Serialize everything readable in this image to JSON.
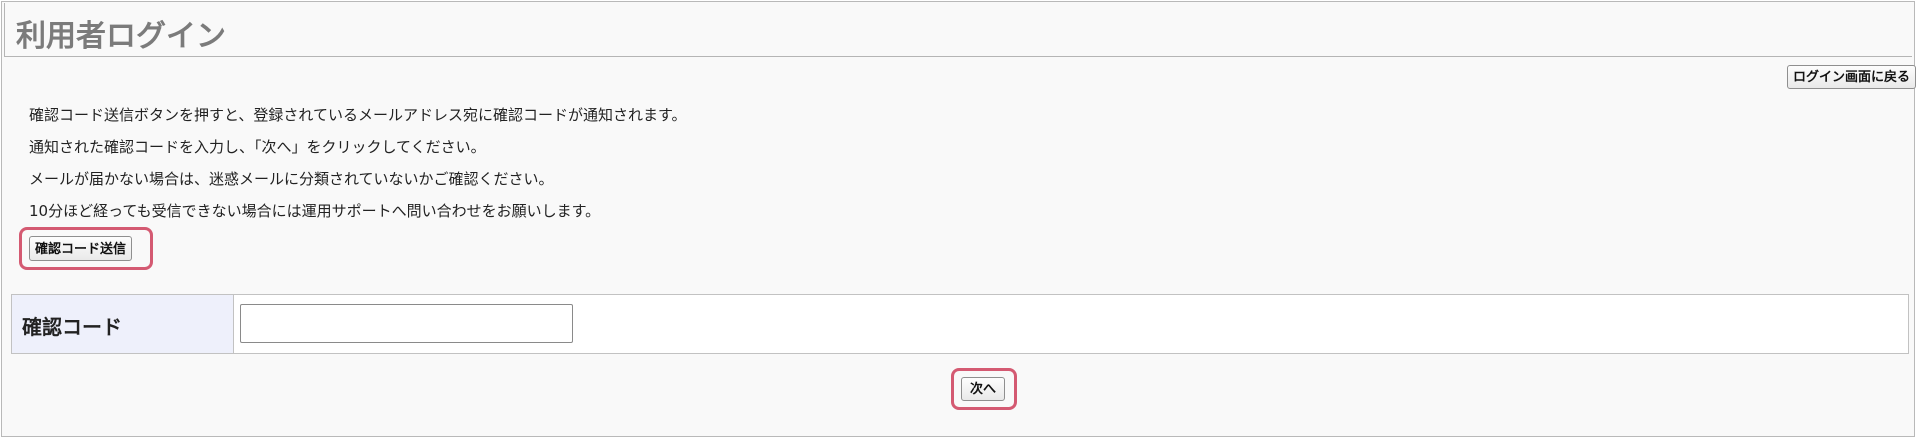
{
  "header": {
    "title": "利用者ログイン"
  },
  "toolbar": {
    "back_label": "ログイン画面に戻る"
  },
  "instructions": [
    "確認コード送信ボタンを押すと、登録されているメールアドレス宛に確認コードが通知されます。",
    "通知された確認コードを入力し、「次へ」をクリックしてください。",
    "メールが届かない場合は、迷惑メールに分類されていないかご確認ください。",
    "10分ほど経っても受信できない場合には運用サポートへ問い合わせをお願いします。"
  ],
  "send_code_button": {
    "label": "確認コード送信"
  },
  "form": {
    "code_label": "確認コード",
    "code_value": "",
    "code_placeholder": ""
  },
  "next_button": {
    "label": "次へ"
  },
  "colors": {
    "highlight": "#d45a72",
    "label_cell_bg": "#eef0fb",
    "title_text": "#7b7b7b"
  }
}
